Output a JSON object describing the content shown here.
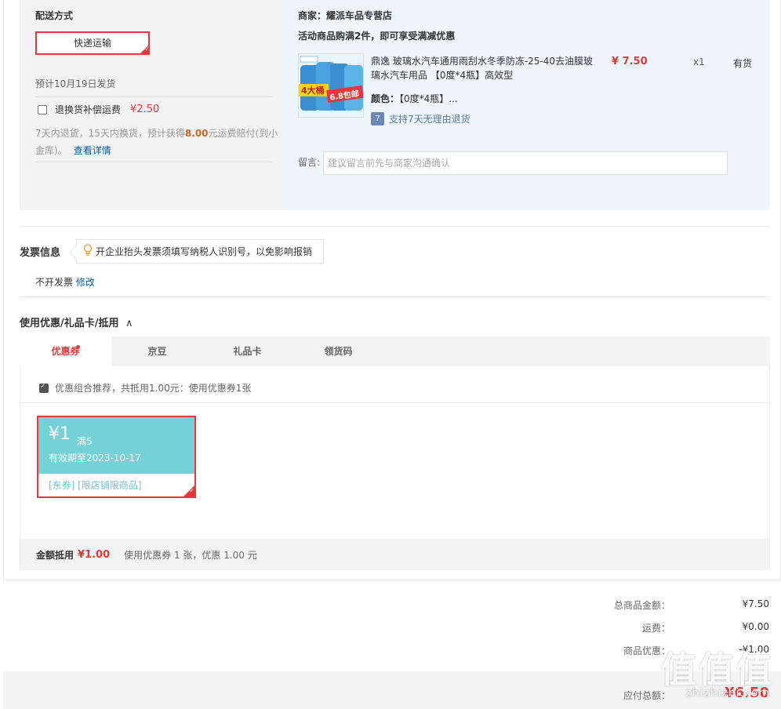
{
  "shipping": {
    "title": "配送方式",
    "method": "快递运输",
    "ship_date": "预计10月19日发货",
    "insurance_label": "退换货补偿运费",
    "insurance_price": "¥2.50",
    "insurance_note_1": "7天内退货，15天内换货，预计获得",
    "insurance_note_amount": "8.00",
    "insurance_note_2": "元运费赔付(到小金库)。",
    "insurance_link": "查看详情"
  },
  "store": {
    "merchant_label": "商家：",
    "merchant_name": "耀派车品专营店",
    "promo": "活动商品购满2件，即可享受满减优惠",
    "product_name": "鼎逸 玻璃水汽车通用雨刮水冬季防冻-25-40去油膜玻璃水汽车用品 【0度*4瓶】高效型",
    "price": "¥ 7.50",
    "qty": "x1",
    "stock": "有货",
    "color_label": "颜色：",
    "color_value": "【0度*4瓶】...",
    "return_badge": "7",
    "return_text": "支持7天无理由退货",
    "thumb_badge_left": "4大桶",
    "thumb_badge_right": "6.8包邮",
    "memo_label": "留言:",
    "memo_placeholder": "建议留言前先与商家沟通确认"
  },
  "invoice": {
    "title": "发票信息",
    "tip_icon": "lightbulb-icon",
    "tip": "开企业抬头发票须填写纳税人识别号，以免影响报销",
    "value": "不开发票",
    "edit_link": "修改"
  },
  "coupons": {
    "title": "使用优惠/礼品卡/抵用",
    "chevron": "∧",
    "tabs": [
      "优惠券",
      "京豆",
      "礼品卡",
      "领货码"
    ],
    "combo_text": "优惠组合推荐，共抵用1.00元：使用优惠券1张",
    "coupon": {
      "amount": "¥1",
      "condition": "满5",
      "expiry": "有效期至2023-10-17",
      "tags": "[东券]  [限店铺限商品]"
    },
    "summary_label": "金额抵用",
    "summary_value": "¥1.00",
    "summary_text": "使用优惠券 1 张，优惠 1.00 元"
  },
  "totals": {
    "goods_label": "总商品金额：",
    "goods_value": "¥7.50",
    "freight_label": "运费：",
    "freight_value": "¥0.00",
    "discount_label": "商品优惠：",
    "discount_value": "-¥1.00",
    "pay_label": "应付总额：",
    "pay_value": "¥6.50"
  },
  "watermark": {
    "logo": "值值值",
    "domain": "zhizhizhi.com"
  },
  "colors": {
    "accent_red": "#e4393c",
    "link_blue": "#005ea7",
    "coupon_teal": "#74d2d6"
  }
}
